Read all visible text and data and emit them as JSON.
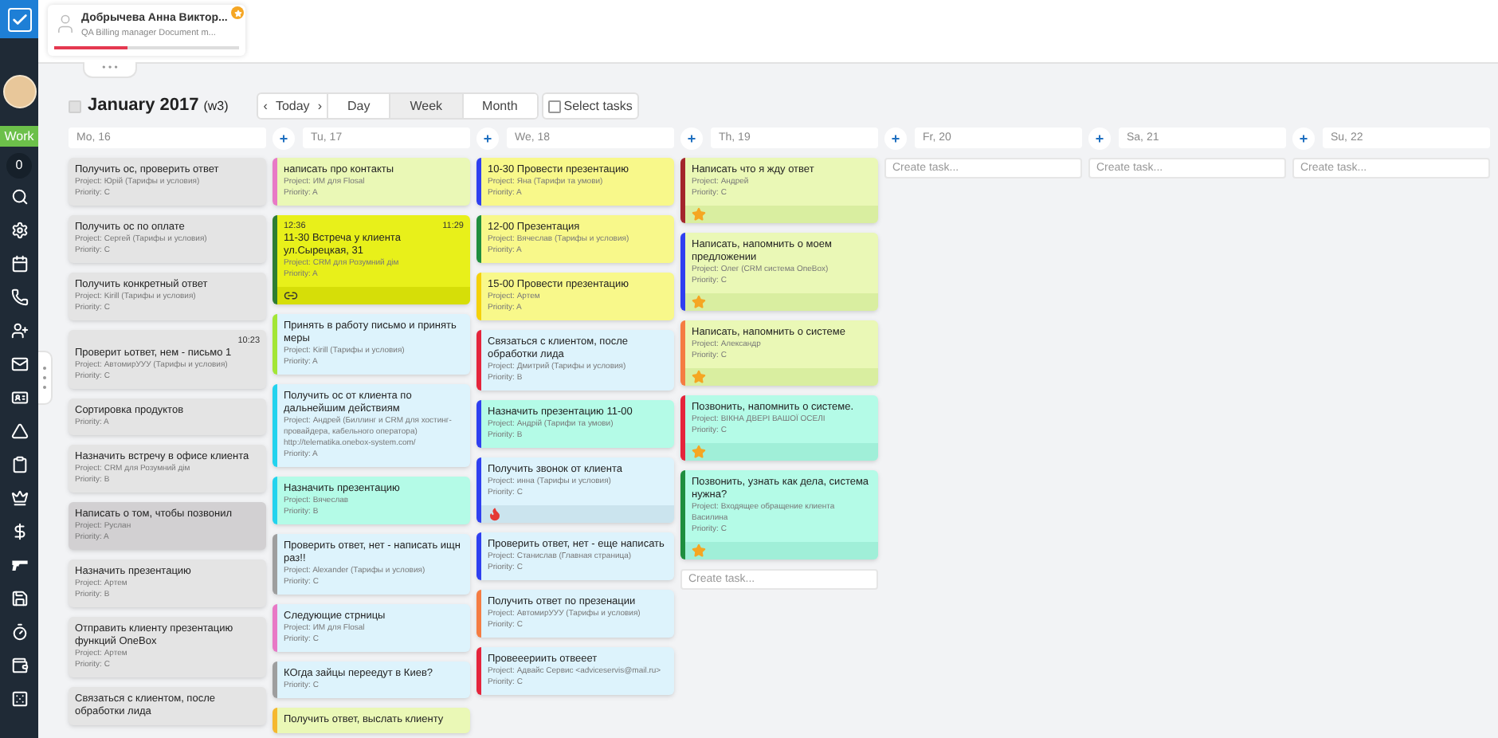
{
  "sidebar": {
    "work_label": "Work",
    "counter": "0"
  },
  "user_card": {
    "name": "Добрычева Анна Виктор...",
    "subtitle": "QA Billing manager Document m...",
    "level": 0.4,
    "more": "• • •"
  },
  "toolbar": {
    "title": "January 2017",
    "week": "(w3)",
    "prev": "‹",
    "today": "Today",
    "next": "›",
    "views": [
      {
        "label": "Day",
        "selected": false
      },
      {
        "label": "Week",
        "selected": true
      },
      {
        "label": "Month",
        "selected": false
      }
    ],
    "select_tasks": {
      "label": "Select tasks",
      "checked": false
    },
    "all_checked": false
  },
  "add_label": "+",
  "days": [
    {
      "label": "Mo, 16",
      "tasks": [
        {
          "kind": "gray",
          "title": "Получить ос, проверить ответ",
          "project": "Project: Юрій (Тарифы и условия)",
          "priority": "Priority: C"
        },
        {
          "kind": "gray",
          "title": "Получить ос по оплате",
          "project": "Project: Сергей (Тарифы и условия)",
          "priority": "Priority: C"
        },
        {
          "kind": "gray",
          "title": "Получить конкретный ответ",
          "project": "Project: Kirill (Тарифы и условия)",
          "priority": "Priority: C"
        },
        {
          "kind": "gray",
          "end_time": "10:23",
          "title": "Проверит ьответ, нем - письмо 1",
          "project": "Project: АвтомирУУУ (Тарифы и условия)",
          "priority": "Priority: C"
        },
        {
          "kind": "gray",
          "title": "Сортировка продуктов",
          "priority": "Priority: A"
        },
        {
          "kind": "gray",
          "title": "Назначить встречу в офисе клиента",
          "project": "Project: CRM для Розумний дім",
          "priority": "Priority: B"
        },
        {
          "kind": "dark",
          "title": "Написать о том, чтобы позвонил",
          "project": "Project: Руслан",
          "priority": "Priority: A"
        },
        {
          "kind": "gray",
          "title": "Назначить презентацию",
          "project": "Project: Артем",
          "priority": "Priority: B"
        },
        {
          "kind": "gray",
          "title": "Отправить клиенту презентацию функций OneBox",
          "project": "Project: Артем",
          "priority": "Priority: C"
        },
        {
          "kind": "gray",
          "title": "Связаться с клиентом, после обработки лида"
        }
      ]
    },
    {
      "label": "Tu, 17",
      "tasks": [
        {
          "kind": "lime",
          "color": "#e879c6",
          "title": "написать про контакты",
          "project": "Project: ИМ для Flosal",
          "priority": "Priority: A"
        },
        {
          "kind": "highlight",
          "color": "#2e7d32",
          "start_time": "12:36",
          "end_time": "11:29",
          "title": "11-30 Встреча у клиента ул.Сырецкая, 31",
          "project": "Project: CRM для Розумний дім",
          "priority": "Priority: A",
          "has_link": true
        },
        {
          "kind": "blue",
          "color": "#a3e635",
          "title": "Принять в работу письмо и принять меры",
          "project": "Project: Kirill (Тарифы и условия)",
          "priority": "Priority: A"
        },
        {
          "kind": "blue",
          "color": "#22d3ee",
          "title": "Получить ос от клиента по дальнейшим действиям",
          "project": "Project: Андрей (Биллинг и CRM для хостинг-провайдера, кабельного оператора)",
          "note": "http://telematika.onebox-system.com/",
          "priority": "Priority: A"
        },
        {
          "kind": "mint",
          "color": "#22d3ee",
          "title": "Назначить презентацию",
          "project": "Project: Вячеслав",
          "priority": "Priority: B"
        },
        {
          "kind": "blue",
          "color": "#9e9e9e",
          "title": "Проверить ответ, нет - написать ищн раз!!",
          "project": "Project: Alexander (Тарифы и условия)",
          "priority": "Priority: C"
        },
        {
          "kind": "blue",
          "color": "#e879c6",
          "title": "Следующие стрницы",
          "project": "Project: ИМ для Flosal",
          "priority": "Priority: C"
        },
        {
          "kind": "blue",
          "color": "#9e9e9e",
          "title": "КОгда зайцы переедут в Киев?",
          "priority": "Priority: C"
        },
        {
          "kind": "lime",
          "color": "#f5b82e",
          "title": "Получить ответ, выслать клиенту"
        }
      ]
    },
    {
      "label": "We, 18",
      "tasks": [
        {
          "kind": "yellow",
          "color": "#2f3ff0",
          "title": "10-30 Провести презентацию",
          "project": "Project: Яна (Тарифи та умови)",
          "priority": "Priority: A"
        },
        {
          "kind": "yellow",
          "color": "#1e8e3e",
          "title": "12-00 Презентация",
          "project": "Project: Вячеслав (Тарифы и условия)",
          "priority": "Priority: A"
        },
        {
          "kind": "yellow",
          "color": "#f5d10a",
          "title": "15-00 Провести презентацию",
          "project": "Project: Артем",
          "priority": "Priority: A"
        },
        {
          "kind": "blue",
          "color": "#e5243b",
          "title": "Связаться с клиентом, после обработки лида",
          "project": "Project: Дмитрий (Тарифы и условия)",
          "priority": "Priority: B"
        },
        {
          "kind": "mint",
          "color": "#2f3ff0",
          "title": "Назначить презентацию 11-00",
          "project": "Project: Андрій (Тарифи та умови)",
          "priority": "Priority: B"
        },
        {
          "kind": "blue",
          "color": "#2f3ff0",
          "title": "Получить звонок от клиента",
          "project": "Project: инна (Тарифы и условия)",
          "priority": "Priority: C",
          "urgent": true
        },
        {
          "kind": "blue",
          "color": "#2f3ff0",
          "title": "Проверить ответ, нет - еще написать",
          "project": "Project: Станислав (Главная страница)",
          "priority": "Priority: C"
        },
        {
          "kind": "blue",
          "color": "#f57c42",
          "title": "Получить ответ по презенации",
          "project": "Project: АвтомирУУУ (Тарифы и условия)",
          "priority": "Priority: C"
        },
        {
          "kind": "blue",
          "color": "#e5243b",
          "title": "Провееериить отвееет",
          "project": "Project: Адвайс Сервис <adviceservis@mail.ru>",
          "priority": "Priority: C"
        }
      ]
    },
    {
      "label": "Th, 19",
      "tasks": [
        {
          "kind": "lime",
          "color": "#a3262c",
          "title": "Написать что я жду ответ",
          "project": "Project: Андрей",
          "priority": "Priority: C",
          "starred": true
        },
        {
          "kind": "lime",
          "color": "#2f3ff0",
          "title": "Написать, напомнить о моем предложении",
          "project": "Project: Олег (CRM система OneBox)",
          "priority": "Priority: C",
          "starred": true
        },
        {
          "kind": "lime",
          "color": "#f57c42",
          "title": "Написать, напомнить о системе",
          "project": "Project: Александр",
          "priority": "Priority: C",
          "starred": true
        },
        {
          "kind": "mint",
          "color": "#e5243b",
          "title": "Позвонить, напомнить о системе.",
          "project": "Project: ВІКНА ДВЕРІ ВАШОЇ ОСЕЛІ",
          "priority": "Priority: C",
          "starred": true
        },
        {
          "kind": "mint",
          "color": "#1e8e3e",
          "title": "Позвонить, узнать как дела, система нужна?",
          "project": "Project: Входящее обращение клиента Василина",
          "priority": "Priority: C",
          "starred": true
        }
      ],
      "create_placeholder": "Create task..."
    },
    {
      "label": "Fr, 20",
      "create_placeholder": "Create task..."
    },
    {
      "label": "Sa, 21",
      "create_placeholder": "Create task..."
    },
    {
      "label": "Su, 22",
      "create_placeholder": "Create task..."
    }
  ]
}
